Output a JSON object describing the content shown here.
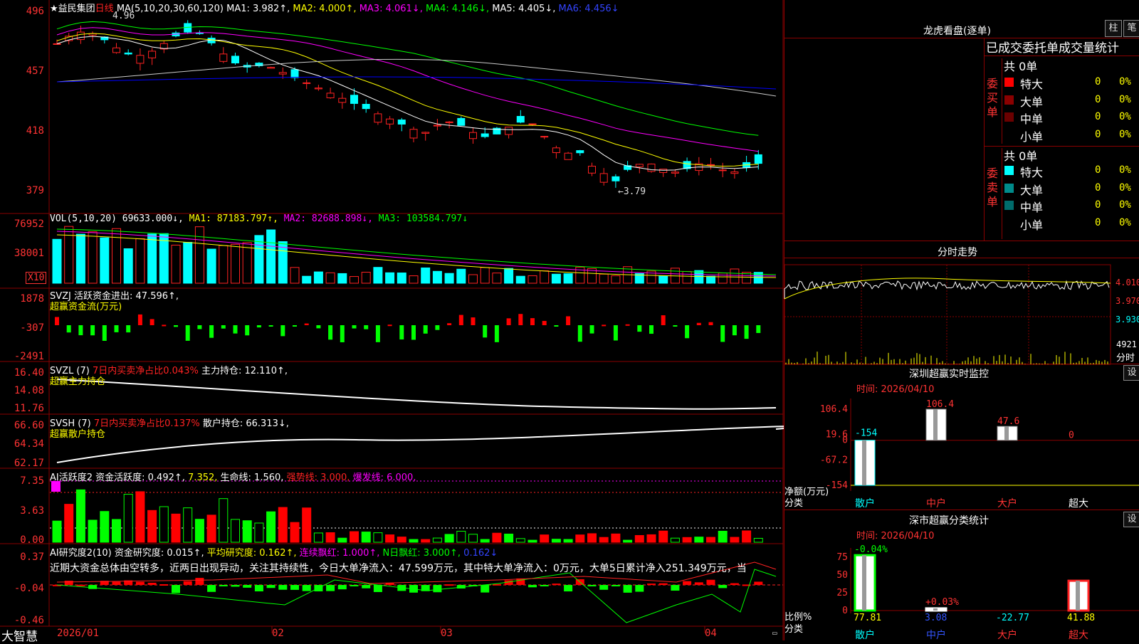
{
  "colors": {
    "up": "#ff2222",
    "down": "#00ffff",
    "ma1": "#ffffff",
    "ma2": "#ffff00",
    "ma3": "#ff00ff",
    "ma4": "#00ff00",
    "ma5": "#ffffff",
    "ma6": "#0000ff",
    "flow_up": "#ff0000",
    "flow_down": "#00ff00",
    "grid": "#8a0000"
  },
  "main": {
    "title": "★益民集团",
    "period": "日线",
    "ma_label": "MA(5,10,20,30,60,120)",
    "ma1": "MA1: 3.982↑,",
    "ma2": "MA2: 4.000↑,",
    "ma3": "MA3: 4.061↓,",
    "ma4": "MA4: 4.146↓,",
    "ma5": "MA5: 4.405↓,",
    "ma6": "MA6: 4.456↓",
    "high_mark": "4.96",
    "low_mark": "←3.79",
    "yticks": [
      "496",
      "457",
      "418",
      "379"
    ]
  },
  "vol": {
    "label": "VOL(5,10,20)",
    "value": "69633.000↓,",
    "ma1": "MA1: 87183.797↑,",
    "ma2": "MA2: 82688.898↓,",
    "ma3": "MA3: 103584.797↓",
    "yticks": [
      "76952",
      "38001"
    ],
    "unit": "X10"
  },
  "svzj": {
    "label": "SVZJ  活跃资金进出: 47.596↑,",
    "sub": "超赢资金流(万元)",
    "yticks": [
      "1878",
      "-307",
      "-2491"
    ]
  },
  "svzl": {
    "label": "SVZL (7)",
    "ratio": "7日内买卖净占比0.043%",
    "hold": "主力持仓: 12.110↑,",
    "sub": "超赢主力持仓",
    "yticks": [
      "16.40",
      "14.08",
      "11.76"
    ]
  },
  "svsh": {
    "label": "SVSH (7)",
    "ratio": "7日内买卖净占比0.137%",
    "hold": "散户持仓: 66.313↓,",
    "sub": "超赢散户持仓",
    "yticks": [
      "66.60",
      "64.34",
      "62.17"
    ]
  },
  "ai1": {
    "label": "AI活跃度2",
    "a": "资金活跃度: 0.492↑,",
    "b": "7.352,",
    "c": "生命线: 1.560,",
    "d": "强势线: 3.000,",
    "e": "爆发线: 6.000,",
    "yticks": [
      "7.35",
      "3.63",
      "0.00"
    ]
  },
  "ai2": {
    "label": "AI研究度2(10)",
    "a": "资金研究度: 0.015↑,",
    "b": "平均研究度: 0.162↑,",
    "c": "连续飘红: 1.000↑,",
    "d": "N日飘红: 3.000↑,",
    "e": "0.162↓",
    "text": "近期大资金总体由空转多，近两日出现异动，关注其持续性，今日大单净流入：47.599万元，其中特大单净流入：0万元，大单5日累计净入251.349万元，当",
    "yticks": [
      "0.37",
      "-0.04",
      "-0.46"
    ]
  },
  "xaxis": {
    "labels": [
      "2026/01",
      "02",
      "03",
      "04"
    ],
    "brand": "大智慧"
  },
  "right": {
    "lhb": "龙虎看盘(逐单)",
    "btn1": "柱",
    "btn2": "笔",
    "stat_title": "已成交委托单成交量统计",
    "buy_total": "共 0单",
    "sell_total": "共 0单",
    "buy_side": "委买单",
    "sell_side": "委卖单",
    "rows": [
      [
        "特大",
        "0",
        "0%"
      ],
      [
        "大单",
        "0",
        "0%"
      ],
      [
        "中单",
        "0",
        "0%"
      ],
      [
        "小单",
        "0",
        "0%"
      ]
    ],
    "fenshi": "分时走势",
    "fs_prices": [
      "4.010",
      "3.970",
      "3.930"
    ],
    "fs_vol": "4921",
    "fs_unit": "分时",
    "monitor_title": "深圳超赢实时监控",
    "set": "设",
    "time1": "时间: 2026/04/10",
    "m_ticks": [
      "106.4",
      "19.6",
      "0",
      "-67.2",
      "-154"
    ],
    "m_axis": "净额(万元)",
    "m_cat": "分类",
    "m_labels": [
      "散户",
      "中户",
      "大户",
      "超大"
    ],
    "m_values": [
      "-154",
      "106.4",
      "47.6",
      "0"
    ],
    "class_title": "深市超赢分类统计",
    "time2": "时间: 2026/04/10",
    "c_ticks": [
      "75",
      "50",
      "25",
      "0"
    ],
    "c_axis": "比例%",
    "c_cat": "分类",
    "c_top": [
      "-0.04%",
      "+0.03%"
    ],
    "c_values": [
      "77.81",
      "3.08",
      "-22.77",
      "41.88"
    ]
  }
}
